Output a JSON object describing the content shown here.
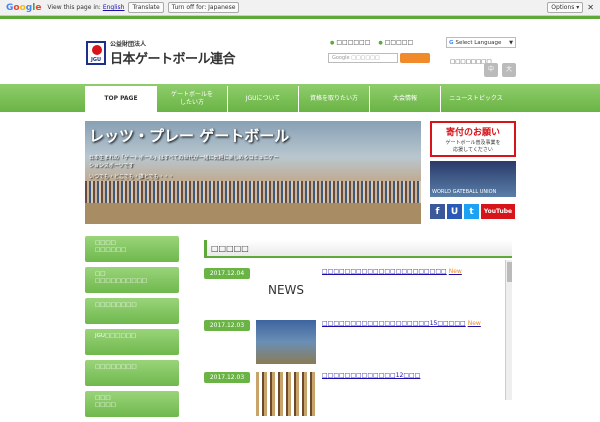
{
  "gbar": {
    "logo": [
      "G",
      "o",
      "o",
      "g",
      "l",
      "e"
    ],
    "view_text": "View this page in:",
    "language": "English",
    "translate": "Translate",
    "turn_off": "Turn off for: Japanese",
    "options": "Options ▾",
    "close": "✕"
  },
  "header": {
    "logo_sub": "公益財団法人",
    "logo_main": "日本ゲートボール連合",
    "logo_mark_text": "JGU",
    "toplinks": [
      "□□□□□□",
      "□□□□□"
    ],
    "search_placeholder": "Google □□□□□□",
    "lang_select": "Select Language",
    "lang_arrow": "▼",
    "links2": "□□□□□□□□",
    "size_small": "中",
    "size_large": "大"
  },
  "nav": {
    "items": [
      "TOP PAGE",
      "ゲートボールを\nしたい方",
      "JGUについて",
      "資格を取りたい方",
      "大会情報",
      "ニューストピックス"
    ]
  },
  "hero": {
    "title": "レッツ・プレー ゲートボール",
    "text": "日本生まれの「ゲートボール」はすべての世代が一緒に気軽に楽しめるコミュニケーションスポーツです",
    "text2": "いつでも・どこでも・誰とでも・・・"
  },
  "donate": {
    "title": "寄付のお願い",
    "sub": "ゲートボール普及事業を\n応援してください"
  },
  "banner2": {
    "text": "WORLD GATEBALL UNION"
  },
  "social": {
    "fb": "f",
    "u": "U",
    "tw": "t",
    "yt": "YouTube"
  },
  "sidebar": {
    "items": [
      "□□□□\n□□□□□□",
      "□□\n□□□□□□□□□□",
      "□□□□□□□□",
      "JGU□□□□□□",
      "□□□□□□□□",
      "□□□\n□□□□"
    ]
  },
  "news": {
    "header": "□□□□□",
    "rows": [
      {
        "date": "2017.12.04",
        "thumb": "NEWS",
        "title": "□□□□□□□□□□□□□□□□□□□□□□",
        "new": "New"
      },
      {
        "date": "2017.12.03",
        "thumb": "",
        "title": "□□□□□□□□□□□□□□□□□□□15□□□□□",
        "new": "New"
      },
      {
        "date": "2017.12.03",
        "thumb": "",
        "title": "□□□□□□□□□□□□□12□□□",
        "new": ""
      }
    ]
  }
}
